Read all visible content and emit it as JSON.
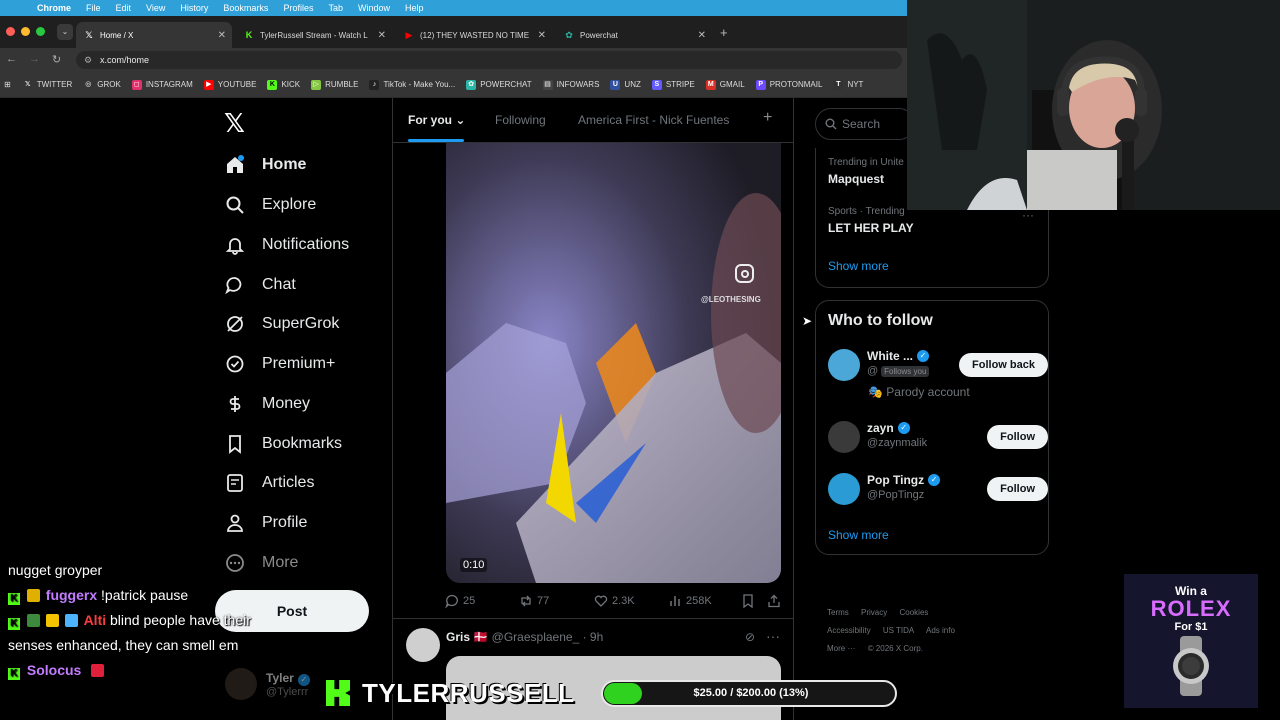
{
  "menubar": {
    "app": "Chrome",
    "items": [
      "File",
      "Edit",
      "View",
      "History",
      "Bookmarks",
      "Profiles",
      "Tab",
      "Window",
      "Help"
    ]
  },
  "tabs": [
    {
      "title": "Home / X",
      "icon": "x-logo-icon"
    },
    {
      "title": "TylerRussell Stream - Watch L",
      "icon": "kick-icon"
    },
    {
      "title": "(12) THEY WASTED NO TIME",
      "icon": "youtube-icon"
    },
    {
      "title": "Powerchat",
      "icon": "powerchat-icon"
    }
  ],
  "address": {
    "url": "x.com/home"
  },
  "bookmarks": [
    {
      "label": "TWITTER",
      "color": "#000000",
      "icon": "x-logo-icon"
    },
    {
      "label": "GROK",
      "color": "#555555",
      "icon": "grok-icon"
    },
    {
      "label": "INSTAGRAM",
      "color": "#e1306c",
      "icon": "instagram-icon"
    },
    {
      "label": "YOUTUBE",
      "color": "#ff0000",
      "icon": "youtube-icon"
    },
    {
      "label": "KICK",
      "color": "#53fc18",
      "icon": "kick-icon"
    },
    {
      "label": "RUMBLE",
      "color": "#85c742",
      "icon": "rumble-icon"
    },
    {
      "label": "TikTok - Make You...",
      "color": "#222222",
      "icon": "tiktok-icon"
    },
    {
      "label": "POWERCHAT",
      "color": "#2ab5a5",
      "icon": "powerchat-icon"
    },
    {
      "label": "INFOWARS",
      "color": "#444444",
      "icon": "infowars-icon"
    },
    {
      "label": "UNZ",
      "color": "#3050a0",
      "icon": "unz-icon"
    },
    {
      "label": "STRIPE",
      "color": "#635bff",
      "icon": "stripe-icon"
    },
    {
      "label": "GMAIL",
      "color": "#d93025",
      "icon": "gmail-icon"
    },
    {
      "label": "PROTONMAIL",
      "color": "#6d4aff",
      "icon": "protonmail-icon"
    },
    {
      "label": "NYT",
      "color": "#333333",
      "icon": "nyt-icon"
    }
  ],
  "xnav": {
    "logo": "𝕏",
    "items": [
      {
        "label": "Home",
        "icon": "home-icon"
      },
      {
        "label": "Explore",
        "icon": "search-icon"
      },
      {
        "label": "Notifications",
        "icon": "bell-icon"
      },
      {
        "label": "Chat",
        "icon": "chat-bubble-icon"
      },
      {
        "label": "SuperGrok",
        "icon": "grok-icon"
      },
      {
        "label": "Premium+",
        "icon": "verified-badge-icon"
      },
      {
        "label": "Money",
        "icon": "dollar-icon"
      },
      {
        "label": "Bookmarks",
        "icon": "bookmark-icon"
      },
      {
        "label": "Articles",
        "icon": "article-icon"
      },
      {
        "label": "Profile",
        "icon": "person-icon"
      },
      {
        "label": "More",
        "icon": "more-circle-icon"
      }
    ],
    "post_label": "Post",
    "account": {
      "name": "Tyler",
      "handle": "@Tylerrr"
    }
  },
  "timeline": {
    "tabs": [
      "For you",
      "Following",
      "America First - Nick Fuentes"
    ],
    "video": {
      "duration": "0:10",
      "watermark": "@LEOTHESING"
    },
    "stats": {
      "replies": "25",
      "reposts": "77",
      "likes": "2.3K",
      "views": "258K"
    },
    "next_post": {
      "name": "Gris",
      "flag": "🇩🇰",
      "handle": "@Graesplaene_",
      "time": "9h"
    }
  },
  "sidebar": {
    "search_placeholder": "Search",
    "trends": [
      {
        "context": "Trending in Unite",
        "title": "Mapquest"
      },
      {
        "context": "Sports · Trending",
        "title": "LET HER PLAY"
      }
    ],
    "show_more": "Show more",
    "who_to_follow_title": "Who to follow",
    "follow_suggestions": [
      {
        "name": "White ...",
        "handle": "@",
        "follows_you": "Follows you",
        "note": "Parody account",
        "button": "Follow back",
        "avatar_color": "#4aa7d8"
      },
      {
        "name": "zayn",
        "handle": "@zaynmalik",
        "button": "Follow",
        "avatar_color": "#3a3a3a"
      },
      {
        "name": "Pop Tingz",
        "handle": "@PopTingz",
        "button": "Follow",
        "avatar_color": "#2b9bd6"
      }
    ],
    "show_more_2": "Show more",
    "footer": [
      "Terms",
      "Privacy",
      "Cookies",
      "Accessibility",
      "US TIDA",
      "Ads info",
      "More ···",
      "© 2026 X Corp."
    ]
  },
  "stream_overlay": {
    "chat": [
      {
        "user": "",
        "text": "nugget groyper"
      },
      {
        "user": "fuggerx",
        "text": "!patrick pause"
      },
      {
        "user": "Alti",
        "text": "blind people have their senses enhanced, they can smell em"
      },
      {
        "user": "Solocus",
        "text": ""
      }
    ],
    "streamer_name": "TYLERRUSSELL",
    "goal": {
      "text": "$25.00 / $200.00 (13%)",
      "progress": 0.13
    },
    "promo": {
      "line1": "Win a",
      "brand": "ROLEX",
      "line2": "For $1"
    }
  }
}
